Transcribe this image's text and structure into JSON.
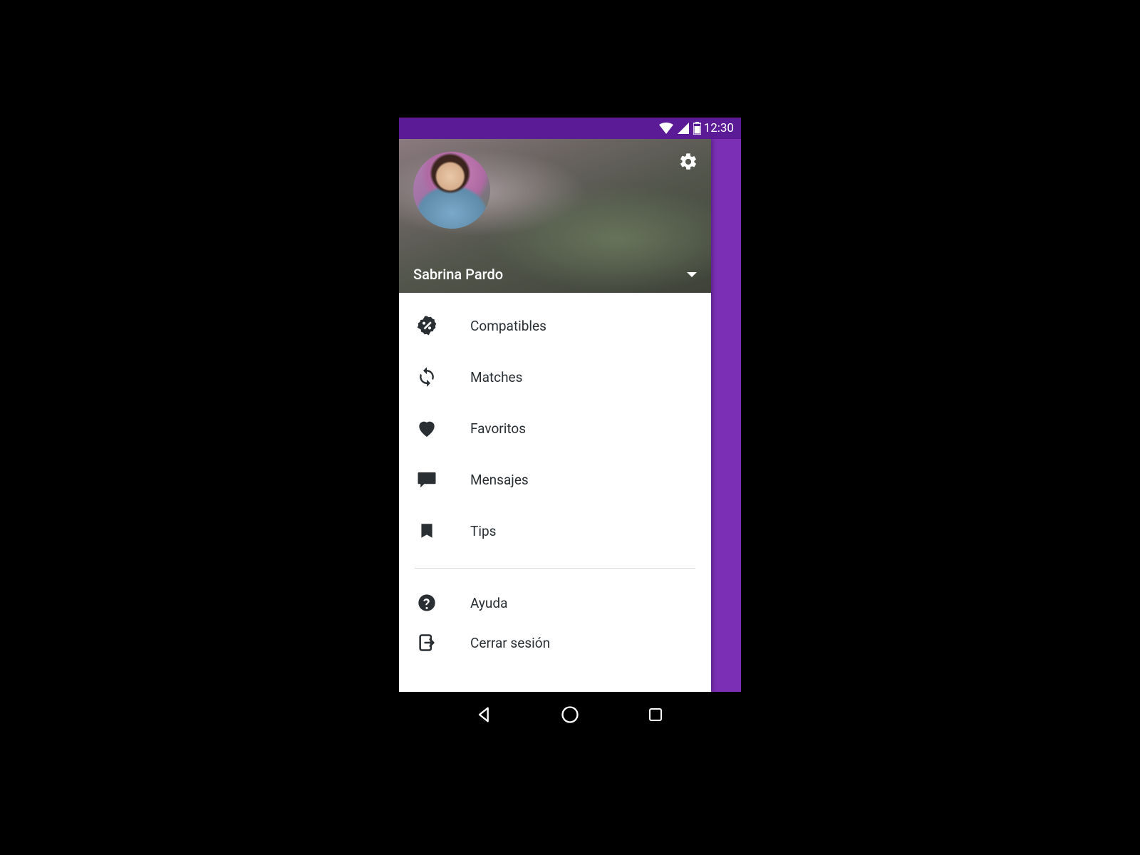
{
  "status": {
    "time": "12:30"
  },
  "header": {
    "user_name": "Sabrina Pardo"
  },
  "menu": {
    "items": [
      {
        "label": "Compatibles"
      },
      {
        "label": "Matches"
      },
      {
        "label": "Favoritos"
      },
      {
        "label": "Mensajes"
      },
      {
        "label": "Tips"
      }
    ],
    "bottom": [
      {
        "label": "Ayuda"
      },
      {
        "label": "Cerrar sesión"
      }
    ]
  },
  "colors": {
    "accent": "#7b2fb5",
    "status_bar": "#5b1a96"
  }
}
